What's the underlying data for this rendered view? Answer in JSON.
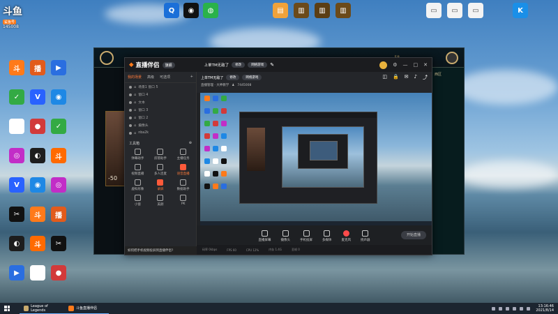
{
  "desktop": {
    "icons": [
      {
        "label": "",
        "color": "#ff7a1a",
        "glyph": "斗"
      },
      {
        "label": "",
        "color": "#e25b1c",
        "glyph": "播"
      },
      {
        "label": "",
        "color": "#2a6ee0",
        "glyph": "▶"
      },
      {
        "label": "",
        "color": "#ffffff",
        "glyph": ""
      },
      {
        "label": "",
        "color": "#d23a3a",
        "glyph": "●"
      },
      {
        "label": "",
        "color": "#33aa44",
        "glyph": "✓"
      },
      {
        "label": "",
        "color": "#2962ff",
        "glyph": "V"
      },
      {
        "label": "",
        "color": "#1e88e5",
        "glyph": "◉"
      },
      {
        "label": "",
        "color": "#c22dc7",
        "glyph": "◎"
      },
      {
        "label": "",
        "color": "#1d1d1d",
        "glyph": "◐"
      },
      {
        "label": "",
        "color": "#ff6a00",
        "glyph": "斗"
      },
      {
        "label": "",
        "color": "#111111",
        "glyph": "✂"
      }
    ],
    "top_logo": "斗鱼",
    "top_sub": "鲨鱼号",
    "top_num": "145008"
  },
  "lol_window": {
    "title_num": "58",
    "side_text": "-50",
    "right_text": "西区"
  },
  "app": {
    "brand": "直播伴侣",
    "badge": "旗舰",
    "live_title": "上单TM无敌了",
    "edit_label": "修改",
    "category": "网络游戏",
    "room_info": "直播管理 · 大神教学",
    "user_count": "7445008",
    "left_tabs": [
      "我的场景",
      "高级",
      "可选项"
    ],
    "sources": [
      "场景1 窗口 5",
      "窗口 4",
      "文本",
      "窗口 3",
      "窗口 2",
      "摄像头",
      "nba2k"
    ],
    "tools_header": "工具箱",
    "tools": [
      "弹幕助手",
      "房管助手",
      "主播任务",
      "视频直播",
      "多人连麦",
      "语音直播",
      "虚拟形象",
      "录屏",
      "数据助手",
      "小窗",
      "美颜",
      "PK"
    ],
    "notice": "如何把手机视频投屏到直播伴侣?",
    "bottom_buttons": [
      "直播屏幕",
      "摄像头",
      "手机投屏",
      "多媒体",
      "麦克风",
      "扬声器"
    ],
    "live_button": "开始直播",
    "status": [
      "码率 0kbps",
      "FPS 60",
      "CPU 12%",
      "内存 1.4G",
      "丢帧 0"
    ]
  },
  "taskbar": {
    "tasks": [
      {
        "label": "League of Legends",
        "color": "#c8aa6e"
      },
      {
        "label": "斗鱼直播伴侣",
        "color": "#ff7a1a"
      }
    ],
    "time": "13:16:46",
    "date": "2021/8/14"
  }
}
